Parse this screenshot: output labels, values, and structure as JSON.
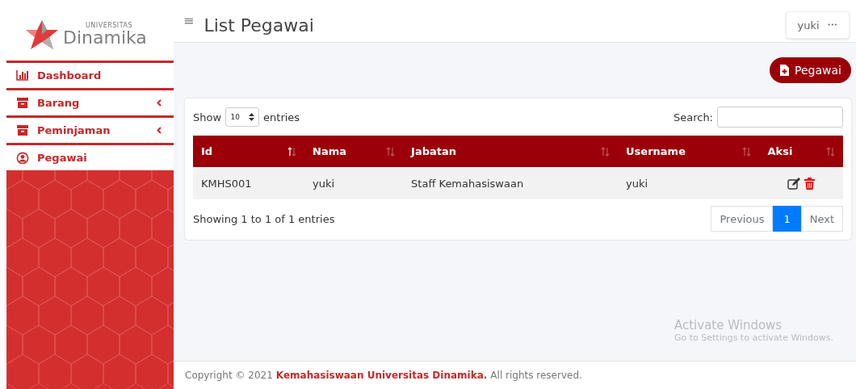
{
  "sidebar": {
    "logo": {
      "small": "UNIVERSITAS",
      "name": "Dinamika"
    },
    "items": [
      {
        "label": "Dashboard",
        "kind": "chart",
        "has_submenu": false
      },
      {
        "label": "Barang",
        "kind": "archive",
        "has_submenu": true
      },
      {
        "label": "Peminjaman",
        "kind": "archive",
        "has_submenu": true
      },
      {
        "label": "Pegawai",
        "kind": "user",
        "has_submenu": false
      }
    ]
  },
  "header": {
    "menu_icon": "≡",
    "title": "List Pegawai",
    "user": "yuki",
    "user_more": "•••"
  },
  "add_button": "Pegawai",
  "table": {
    "show_label": "Show",
    "page_size": "10",
    "entries_label": "entries",
    "search_label": "Search:",
    "columns": [
      {
        "label": "Id",
        "sorted": true
      },
      {
        "label": "Nama",
        "sorted": false
      },
      {
        "label": "Jabatan",
        "sorted": false
      },
      {
        "label": "Username",
        "sorted": false
      },
      {
        "label": "Aksi",
        "sorted": false
      }
    ],
    "rows": [
      {
        "cells": [
          "KMHS001",
          "yuki",
          "Staff Kemahasiswaan",
          "yuki"
        ]
      }
    ],
    "info": "Showing 1 to 1 of 1 entries",
    "pagination": [
      {
        "label": "Previous",
        "kind": "prev",
        "selected": false
      },
      {
        "label": "1",
        "kind": "page",
        "selected": true
      },
      {
        "label": "Next",
        "kind": "next",
        "selected": false
      }
    ]
  },
  "footer": {
    "prefix": "Copyright © 2021",
    "link": "Kemahasiswaan Universitas Dinamika.",
    "suffix": "All rights reserved."
  },
  "os_notice": {
    "title": "Activate Windows",
    "text": "Go to Settings to activate Windows."
  }
}
